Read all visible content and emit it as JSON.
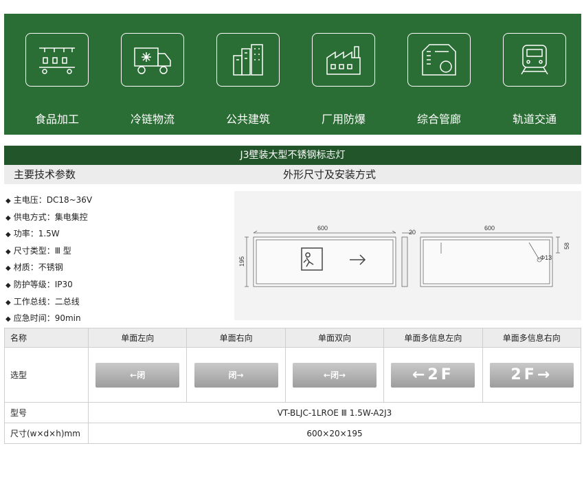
{
  "apps": [
    {
      "label": "食品加工",
      "icon": "food-processing-icon"
    },
    {
      "label": "冷链物流",
      "icon": "cold-chain-truck-icon"
    },
    {
      "label": "公共建筑",
      "icon": "public-building-icon"
    },
    {
      "label": "厂用防爆",
      "icon": "factory-icon"
    },
    {
      "label": "综合管廊",
      "icon": "utility-tunnel-icon"
    },
    {
      "label": "轨道交通",
      "icon": "train-icon"
    }
  ],
  "title": "J3壁装大型不锈钢标志灯",
  "left_header": "主要技术参数",
  "right_header": "外形尺寸及安装方式",
  "specs": [
    "主电压：DC18~36V",
    "供电方式：集电集控",
    "功率：1.5W",
    "尺寸类型：Ⅲ 型",
    "材质：不锈钢",
    "防护等级：IP30",
    "工作总线：二总线",
    "应急时间：90min"
  ],
  "dims": {
    "w1": "600",
    "d": "20",
    "w2": "600",
    "h1": "195",
    "h2": "58",
    "hole": "Φ13"
  },
  "table": {
    "name_label": "名称",
    "type_label": "选型",
    "model_label": "型号",
    "size_label": "尺寸(w×d×h)mm",
    "columns": [
      "单面左向",
      "单面右向",
      "单面双向",
      "单面多信息左向",
      "单面多信息右向"
    ],
    "signs": [
      "←闭",
      "闭→",
      "←闭→",
      "←2F",
      "2F→"
    ],
    "model": "VT-BLJC-1LROE Ⅲ 1.5W-A2J3",
    "size": "600×20×195"
  },
  "colors": {
    "banner": "#2b6e35",
    "title_bar": "#23552b",
    "header_bg": "#ececec"
  }
}
